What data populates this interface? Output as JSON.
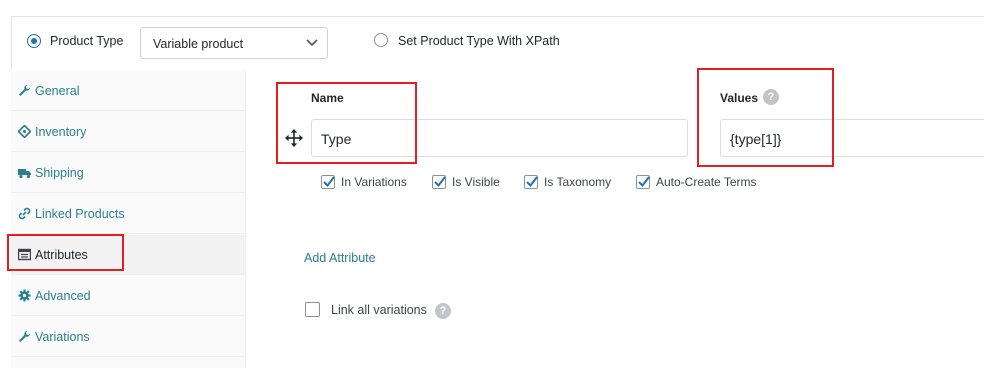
{
  "product_type": {
    "radio_label": "Product Type",
    "selected_value": "Variable product",
    "xpath_radio_label": "Set Product Type With XPath"
  },
  "sidebar": {
    "items": [
      {
        "label": "General",
        "icon": "wrench-icon"
      },
      {
        "label": "Inventory",
        "icon": "tag-icon"
      },
      {
        "label": "Shipping",
        "icon": "truck-icon"
      },
      {
        "label": "Linked Products",
        "icon": "link-icon"
      },
      {
        "label": "Attributes",
        "icon": "list-icon"
      },
      {
        "label": "Advanced",
        "icon": "gear-icon"
      },
      {
        "label": "Variations",
        "icon": "wrench-icon"
      }
    ],
    "active": "Attributes"
  },
  "attribute": {
    "name_label": "Name",
    "name_value": "Type",
    "values_label": "Values",
    "values_value": "{type[1]}",
    "help_symbol": "?",
    "checkboxes": [
      {
        "label": "In Variations",
        "checked": true
      },
      {
        "label": "Is Visible",
        "checked": true
      },
      {
        "label": "Is Taxonomy",
        "checked": true
      },
      {
        "label": "Auto-Create Terms",
        "checked": true
      }
    ]
  },
  "add_attribute_label": "Add Attribute",
  "link_all_variations": {
    "label": "Link all variations",
    "checked": false
  },
  "colors": {
    "accent": "#2271b1",
    "link": "#2a7f8f",
    "annotation": "#e02020"
  }
}
